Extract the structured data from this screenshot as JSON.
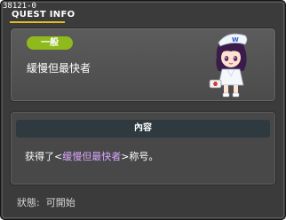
{
  "window": {
    "quest_id": "38121-0",
    "title": "QUEST INFO"
  },
  "header": {
    "category": "一般",
    "quest_name": "緩慢但最快者",
    "npc_icon": "npc-nurse-portrait-icon"
  },
  "content": {
    "section_title": "內容",
    "text_before": "获得了<",
    "text_highlight": "缓慢但最快者",
    "text_after": ">称号。"
  },
  "status": {
    "label": "狀態:",
    "value": "可開始"
  },
  "colors": {
    "window_bg": "#3b3b3b",
    "badge_green": "#8fba1c",
    "title_accent": "#e0c020",
    "highlight_purple": "#d9a6ff",
    "content_header_bg": "#2e3a40"
  }
}
